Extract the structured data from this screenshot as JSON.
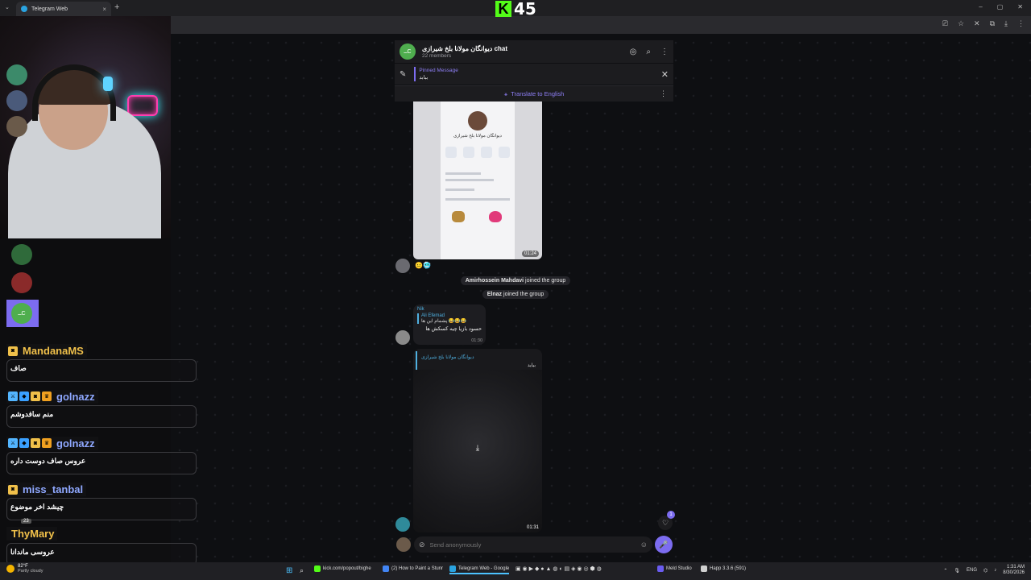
{
  "browser": {
    "tab_title": "Telegram Web",
    "tab_close": "×",
    "new_tab": "+",
    "window_controls": [
      "–",
      "▢",
      "✕"
    ]
  },
  "overlay": {
    "brand_letter": "K",
    "viewer_count": "45"
  },
  "chat_header": {
    "title": "دیوانگان مولانا بلخ شیرازی chat",
    "members": "22 members",
    "avatar_initials": "ــC"
  },
  "pinned": {
    "label": "Pinned Message",
    "text": "ببابد"
  },
  "translate": {
    "label": "Translate to English"
  },
  "messages": {
    "media1": {
      "profile_title": "دیوانگان مولانا بلخ شیرازی",
      "time": "01:24"
    },
    "service1": {
      "name": "Amirhossein Mahdavi",
      "action": "joined the group"
    },
    "service2": {
      "name": "Elnaz",
      "action": "joined the group"
    },
    "reply_bubble": {
      "sender": "Nik",
      "reply_name": "Ali Efemad",
      "reply_text": "پشمام این ها 😂😂😂",
      "text": "حسود بازیا چیه کسکش ها",
      "time": "01:30"
    },
    "media2": {
      "reply_name": "دیوانگان مولانا بلخ شیرازی",
      "reply_text": "بیاید",
      "time": "01:31"
    }
  },
  "scroll_badge": "1",
  "composer": {
    "placeholder": "Send anonymously"
  },
  "stream_chat": [
    {
      "user": "MandanaMS",
      "color": "#f0c04a",
      "text": "صاف"
    },
    {
      "user": "golnazz",
      "color": "#8fa8ff",
      "text": "منم سافدوشم"
    },
    {
      "user": "golnazz",
      "color": "#8fa8ff",
      "text": "عروس صاف دوست داره"
    },
    {
      "user": "miss_tanbal",
      "color": "#8fa8ff",
      "text": "چیشد اخر موضوع"
    },
    {
      "user": "ThyMary",
      "color": "#f0c04a",
      "text": "عروسی ماندانا"
    }
  ],
  "sub_badge_number": "23",
  "taskbar": {
    "weather_temp": "82°F",
    "weather_cond": "Partly cloudy",
    "apps": [
      {
        "label": "kick.com/popout/bighe",
        "color": "#53fc18"
      },
      {
        "label": "(2) How to Paint a Stunr",
        "color": "#4285f4"
      },
      {
        "label": "Telegram Web - Google",
        "color": "#2aa3e0"
      },
      {
        "label": "Meld Studio",
        "color": "#6a5cf0"
      },
      {
        "label": "Happ 3.3.6 (591)",
        "color": "#d0d0d0"
      }
    ],
    "language": "ENG",
    "time": "1:31 AM",
    "date": "8/30/2026"
  },
  "colors": {
    "accent": "#7c6cf0",
    "link": "#4fb0e0",
    "kick_green": "#53fc18"
  }
}
